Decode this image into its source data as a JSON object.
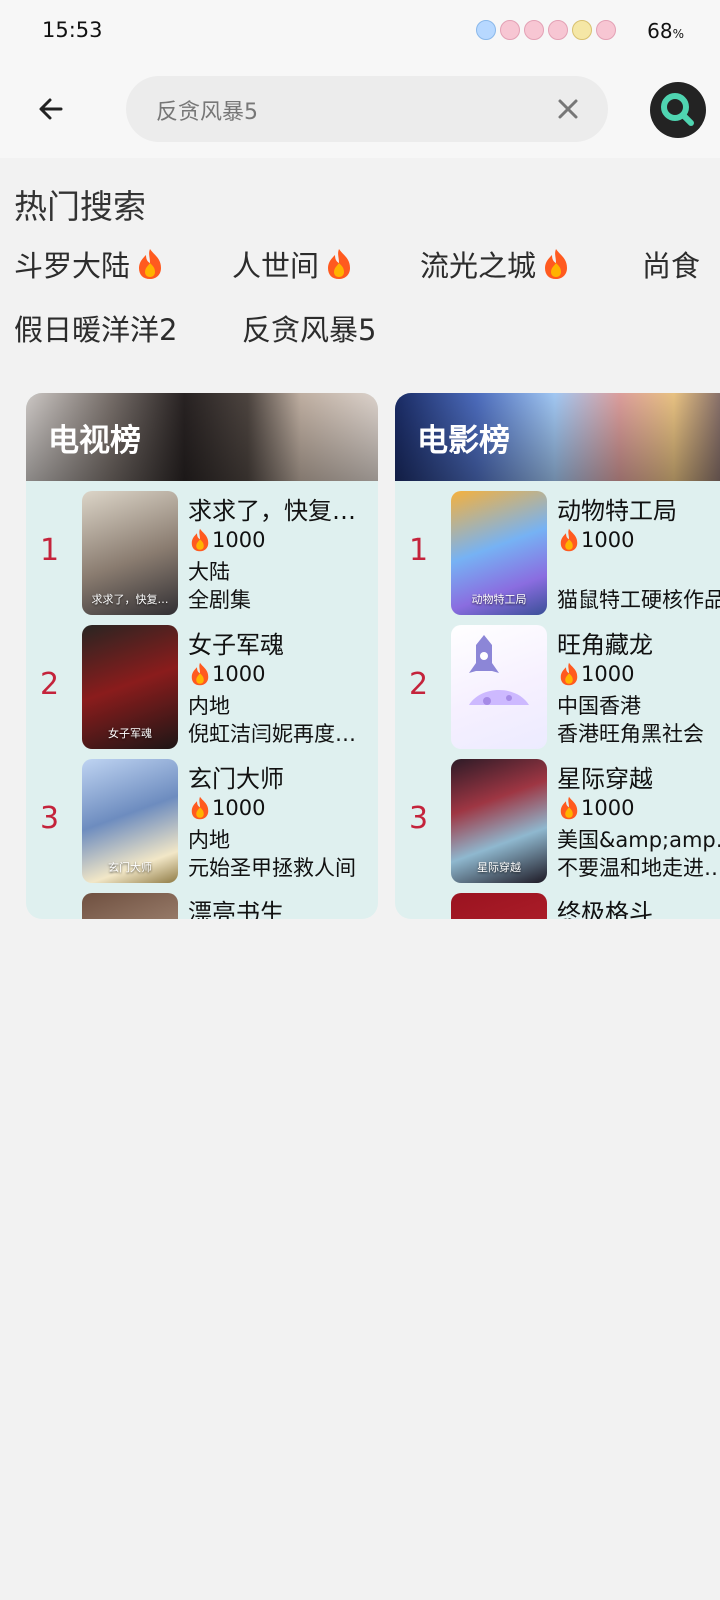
{
  "status_bar": {
    "time": "15:53",
    "battery": "68",
    "battery_unit": "%"
  },
  "search": {
    "value": "反贪风暴5"
  },
  "hot_search": {
    "title": "热门搜索",
    "tags": [
      {
        "label": "斗罗大陆",
        "hot": true
      },
      {
        "label": "人世间",
        "hot": true
      },
      {
        "label": "流光之城",
        "hot": true
      },
      {
        "label": "尚食",
        "hot": false
      },
      {
        "label": "假日暖洋洋2",
        "hot": false
      },
      {
        "label": "反贪风暴5",
        "hot": false
      }
    ]
  },
  "tv_rank": {
    "title": "电视榜",
    "items": [
      {
        "rank": "1",
        "title": "求求了，快复…",
        "heat": "1000",
        "region": "大陆",
        "desc": "全剧集"
      },
      {
        "rank": "2",
        "title": "女子军魂",
        "heat": "1000",
        "region": "内地",
        "desc": "倪虹洁闫妮再度…"
      },
      {
        "rank": "3",
        "title": "玄门大师",
        "heat": "1000",
        "region": "内地",
        "desc": "元始圣甲拯救人间"
      },
      {
        "rank": "",
        "title": "漂亮书生",
        "heat": "",
        "region": "",
        "desc": ""
      }
    ]
  },
  "movie_rank": {
    "title": "电影榜",
    "items": [
      {
        "rank": "1",
        "title": "动物特工局",
        "heat": "1000",
        "region": "",
        "desc": "猫鼠特工硬核作品"
      },
      {
        "rank": "2",
        "title": "旺角藏龙",
        "heat": "1000",
        "region": "中国香港",
        "desc": "香港旺角黑社会"
      },
      {
        "rank": "3",
        "title": "星际穿越",
        "heat": "1000",
        "region": "美国&amp;amp;…",
        "desc": "不要温和地走进…"
      },
      {
        "rank": "",
        "title": "终极格斗",
        "heat": "",
        "region": "",
        "desc": ""
      }
    ]
  },
  "colors": {
    "rank_number": "#c4233b",
    "card_background": "#dff0ef",
    "search_button": "#232323",
    "fire_icon": "#ff5a1f"
  },
  "icons": {
    "back": "arrow-left-icon",
    "clear": "close-icon",
    "search": "search-icon",
    "hot": "flame-icon"
  }
}
